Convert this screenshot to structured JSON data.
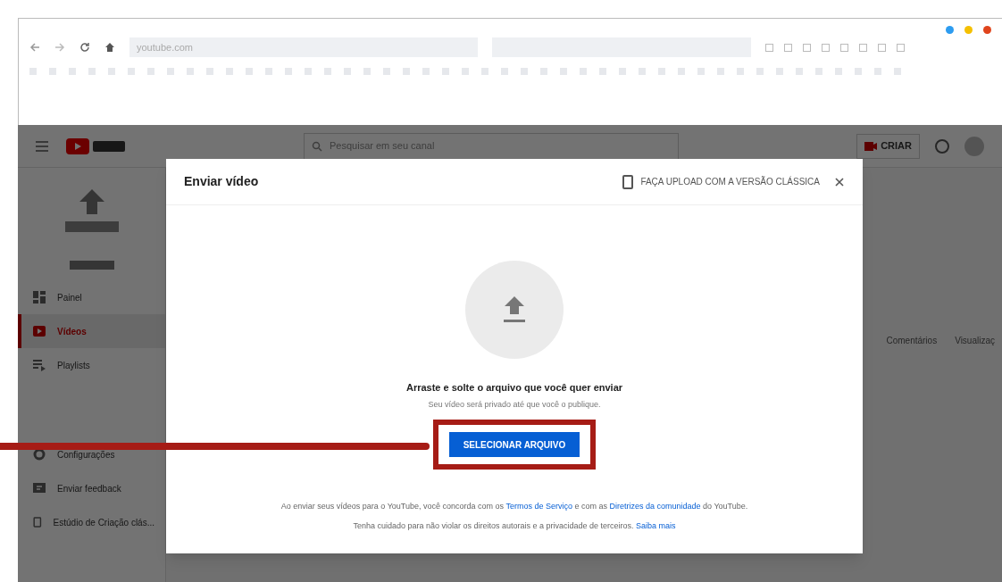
{
  "browser": {
    "address": "youtube.com"
  },
  "header": {
    "search_placeholder": "Pesquisar em seu canal",
    "create_label": "CRIAR"
  },
  "sidebar": {
    "items": [
      {
        "label": "Painel",
        "kind": "dashboard",
        "selected": false
      },
      {
        "label": "Vídeos",
        "kind": "video",
        "selected": true
      },
      {
        "label": "Playlists",
        "kind": "playlist",
        "selected": false
      },
      {
        "label": "Configurações",
        "kind": "settings",
        "selected": false
      },
      {
        "label": "Enviar feedback",
        "kind": "feedback",
        "selected": false
      },
      {
        "label": "Estúdio de Criação clás...",
        "kind": "phone",
        "selected": false
      }
    ]
  },
  "background_columns": [
    "Comentários",
    "Visualizaç"
  ],
  "dialog": {
    "title": "Enviar vídeo",
    "classic_link": "FAÇA UPLOAD COM A VERSÃO CLÁSSICA",
    "drop_title": "Arraste e solte o arquivo que você quer enviar",
    "drop_subtitle": "Seu vídeo será privado até que você o publique.",
    "button": "SELECIONAR ARQUIVO",
    "terms": [
      {
        "kind": "text",
        "text": "Ao enviar seus vídeos para o YouTube, você concorda com os "
      },
      {
        "kind": "link",
        "text": "Termos de Serviço"
      },
      {
        "kind": "text",
        "text": " e com as "
      },
      {
        "kind": "link",
        "text": "Diretrizes da comunidade"
      },
      {
        "kind": "text",
        "text": " do YouTube."
      }
    ],
    "privacy": [
      {
        "kind": "text",
        "text": "Tenha cuidado para não violar os direitos autorais e a privacidade de terceiros. "
      },
      {
        "kind": "link",
        "text": "Saiba mais"
      }
    ]
  }
}
